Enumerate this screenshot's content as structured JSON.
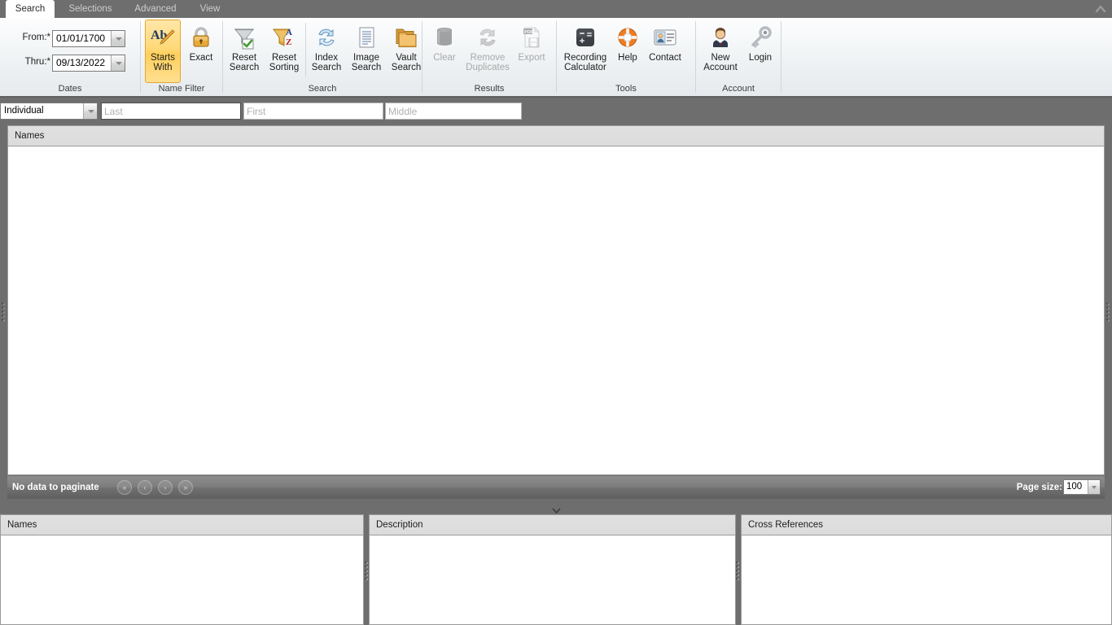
{
  "window": {
    "title": "Search"
  },
  "ribbon": {
    "tabs": [
      {
        "label": "Search",
        "active": true
      },
      {
        "label": "Selections",
        "active": false
      },
      {
        "label": "Advanced",
        "active": false
      },
      {
        "label": "View",
        "active": false
      }
    ],
    "collapse_icon": "chevron-up-icon",
    "groups": [
      {
        "name": "dates",
        "label": "Dates",
        "fields": [
          {
            "label": "From:*",
            "value": "01/01/1700",
            "icon": "dropdown-arrow-icon"
          },
          {
            "label": "Thru:*",
            "value": "09/13/2022",
            "icon": "dropdown-arrow-icon"
          }
        ]
      },
      {
        "name": "name-filter",
        "label": "Name Filter",
        "buttons": [
          {
            "caption": "Starts\nWith",
            "icon": "ab-pencil-icon",
            "selected": true,
            "disabled": false
          },
          {
            "caption": "Exact",
            "icon": "padlock-icon",
            "selected": false,
            "disabled": false
          }
        ]
      },
      {
        "name": "search",
        "label": "Search",
        "buttons": [
          {
            "caption": "Reset\nSearch",
            "icon": "funnel-check-icon",
            "selected": false,
            "disabled": false
          },
          {
            "caption": "Reset\nSorting",
            "icon": "funnel-az-icon",
            "selected": false,
            "disabled": false
          },
          {
            "caption": "Index\nSearch",
            "icon": "refresh-arrows-icon",
            "selected": false,
            "disabled": false
          },
          {
            "caption": "Image\nSearch",
            "icon": "document-lines-icon",
            "selected": false,
            "disabled": false
          },
          {
            "caption": "Vault\nSearch",
            "icon": "folders-icon",
            "selected": false,
            "disabled": false
          }
        ]
      },
      {
        "name": "results",
        "label": "Results",
        "buttons": [
          {
            "caption": "Clear",
            "icon": "trash-can-icon",
            "selected": false,
            "disabled": true
          },
          {
            "caption": "Remove\nDuplicates",
            "icon": "recycle-arrows-icon",
            "selected": false,
            "disabled": true
          },
          {
            "caption": "Export",
            "icon": "pdf-save-icon",
            "selected": false,
            "disabled": true
          }
        ]
      },
      {
        "name": "tools",
        "label": "Tools",
        "buttons": [
          {
            "caption": "Recording\nCalculator",
            "icon": "calculator-icon",
            "selected": false,
            "disabled": false
          },
          {
            "caption": "Help",
            "icon": "life-ring-icon",
            "selected": false,
            "disabled": false
          },
          {
            "caption": "Contact",
            "icon": "contact-card-icon",
            "selected": false,
            "disabled": false
          }
        ]
      },
      {
        "name": "account",
        "label": "Account",
        "buttons": [
          {
            "caption": "New\nAccount",
            "icon": "person-suit-icon",
            "selected": false,
            "disabled": false
          },
          {
            "caption": "Login",
            "icon": "key-icon",
            "selected": false,
            "disabled": false
          }
        ]
      }
    ]
  },
  "search_bar": {
    "type_select": {
      "value": "Individual",
      "icon": "dropdown-arrow-icon"
    },
    "last": {
      "value": "",
      "placeholder": "Last",
      "focused": true
    },
    "first": {
      "value": "",
      "placeholder": "First",
      "focused": false
    },
    "middle": {
      "value": "",
      "placeholder": "Middle",
      "focused": false
    }
  },
  "results_grid": {
    "columns": [
      "Names"
    ],
    "rows": []
  },
  "pager": {
    "status": "No data to paginate",
    "buttons": [
      {
        "name": "first-page-button",
        "glyph": "«"
      },
      {
        "name": "prev-page-button",
        "glyph": "‹"
      },
      {
        "name": "next-page-button",
        "glyph": "›"
      },
      {
        "name": "last-page-button",
        "glyph": "»"
      }
    ],
    "page_size_label": "Page size:",
    "page_size_value": "100"
  },
  "detail_panels": [
    {
      "title": "Names",
      "content": ""
    },
    {
      "title": "Description",
      "content": ""
    },
    {
      "title": "Cross References",
      "content": ""
    }
  ],
  "colors": {
    "chrome": "#6e6e6e",
    "ribbon_bg": "#eef1f3",
    "selected_button": "#ffcf5c",
    "header_bg": "#dcdcdc",
    "pager_bg": "#7e7e7e",
    "panel_bg": "#ffffff"
  }
}
